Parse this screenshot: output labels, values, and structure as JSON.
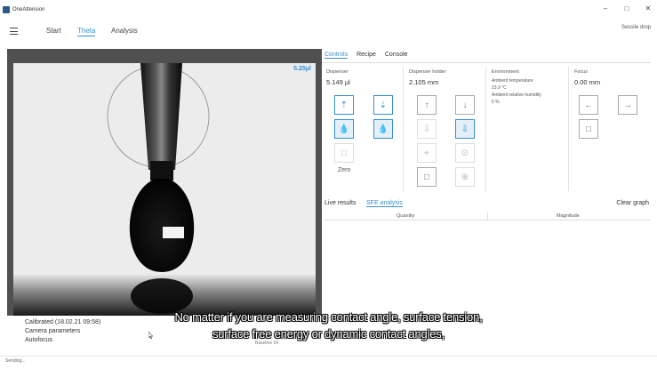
{
  "window": {
    "title": "OneAttension",
    "controls": [
      "–",
      "□",
      "✕"
    ]
  },
  "nav": {
    "tabs": [
      "Start",
      "Theta",
      "Analysis"
    ],
    "active": "Theta",
    "mode": "Sessile drop"
  },
  "camera": {
    "volume": "5.25μl"
  },
  "camera_links": [
    "Calibrated (18.02.21 09:58)",
    "Camera parameters",
    "Autofocus"
  ],
  "baseline_label": "Baseline 09",
  "panel_tabs": [
    "Controls",
    "Recipe",
    "Console"
  ],
  "dispenser": {
    "title": "Dispenser",
    "value": "5.149 μl",
    "zero_label": "Zero"
  },
  "holder": {
    "title": "Dispenser holder",
    "value": "2.105 mm"
  },
  "environment": {
    "title": "Environment",
    "temp_label": "Ambient temperature",
    "temp_value": "23.9 °C",
    "hum_label": "Ambient relative humidity",
    "hum_value": "6 %"
  },
  "focus": {
    "title": "Focus",
    "value": "0.00 mm"
  },
  "results": {
    "tabs": [
      "Live results",
      "SFE analysis"
    ],
    "clear_label": "Clear graph",
    "col_quantity": "Quantity",
    "col_magnitude": "Magnitude"
  },
  "subtitles": [
    "No matter if you are measuring contact angle, surface tension,",
    "surface free energy or dynamic contact angles,"
  ],
  "status": "Sending...",
  "icons": {
    "dispense_up": "syringe-up-icon",
    "dispense_drop": "drop-icon",
    "dispense_down": "syringe-down-icon",
    "arrow_up": "arrow-up-icon",
    "arrow_down": "arrow-down-icon",
    "arrow_left": "arrow-left-icon",
    "arrow_right": "arrow-right-icon",
    "stop": "stop-icon",
    "target": "target-icon",
    "location": "location-pin-icon"
  },
  "colors": {
    "accent": "#3a8fd0",
    "camera_border": "#505050"
  }
}
